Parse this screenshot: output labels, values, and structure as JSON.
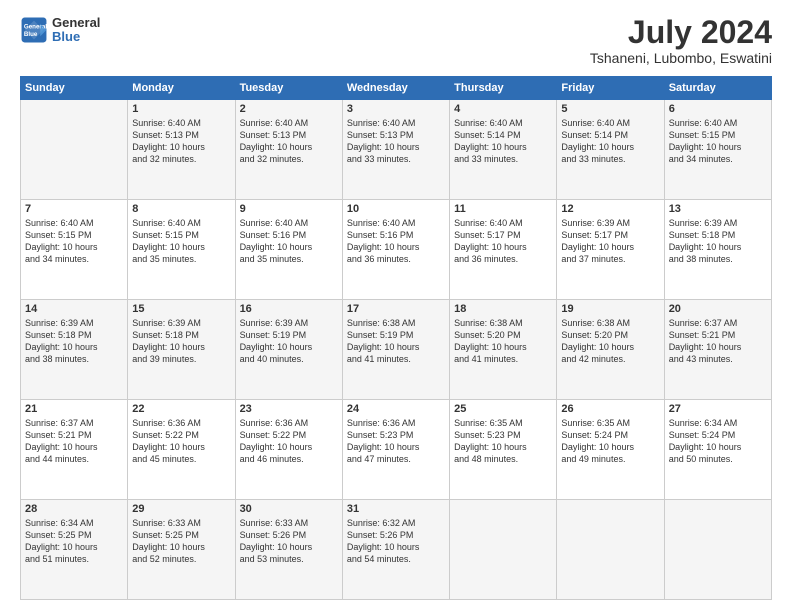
{
  "header": {
    "logo_line1": "General",
    "logo_line2": "Blue",
    "month": "July 2024",
    "location": "Tshaneni, Lubombo, Eswatini"
  },
  "days_of_week": [
    "Sunday",
    "Monday",
    "Tuesday",
    "Wednesday",
    "Thursday",
    "Friday",
    "Saturday"
  ],
  "weeks": [
    [
      {
        "day": "",
        "content": ""
      },
      {
        "day": "1",
        "content": "Sunrise: 6:40 AM\nSunset: 5:13 PM\nDaylight: 10 hours\nand 32 minutes."
      },
      {
        "day": "2",
        "content": "Sunrise: 6:40 AM\nSunset: 5:13 PM\nDaylight: 10 hours\nand 32 minutes."
      },
      {
        "day": "3",
        "content": "Sunrise: 6:40 AM\nSunset: 5:13 PM\nDaylight: 10 hours\nand 33 minutes."
      },
      {
        "day": "4",
        "content": "Sunrise: 6:40 AM\nSunset: 5:14 PM\nDaylight: 10 hours\nand 33 minutes."
      },
      {
        "day": "5",
        "content": "Sunrise: 6:40 AM\nSunset: 5:14 PM\nDaylight: 10 hours\nand 33 minutes."
      },
      {
        "day": "6",
        "content": "Sunrise: 6:40 AM\nSunset: 5:15 PM\nDaylight: 10 hours\nand 34 minutes."
      }
    ],
    [
      {
        "day": "7",
        "content": "Sunrise: 6:40 AM\nSunset: 5:15 PM\nDaylight: 10 hours\nand 34 minutes."
      },
      {
        "day": "8",
        "content": "Sunrise: 6:40 AM\nSunset: 5:15 PM\nDaylight: 10 hours\nand 35 minutes."
      },
      {
        "day": "9",
        "content": "Sunrise: 6:40 AM\nSunset: 5:16 PM\nDaylight: 10 hours\nand 35 minutes."
      },
      {
        "day": "10",
        "content": "Sunrise: 6:40 AM\nSunset: 5:16 PM\nDaylight: 10 hours\nand 36 minutes."
      },
      {
        "day": "11",
        "content": "Sunrise: 6:40 AM\nSunset: 5:17 PM\nDaylight: 10 hours\nand 36 minutes."
      },
      {
        "day": "12",
        "content": "Sunrise: 6:39 AM\nSunset: 5:17 PM\nDaylight: 10 hours\nand 37 minutes."
      },
      {
        "day": "13",
        "content": "Sunrise: 6:39 AM\nSunset: 5:18 PM\nDaylight: 10 hours\nand 38 minutes."
      }
    ],
    [
      {
        "day": "14",
        "content": "Sunrise: 6:39 AM\nSunset: 5:18 PM\nDaylight: 10 hours\nand 38 minutes."
      },
      {
        "day": "15",
        "content": "Sunrise: 6:39 AM\nSunset: 5:18 PM\nDaylight: 10 hours\nand 39 minutes."
      },
      {
        "day": "16",
        "content": "Sunrise: 6:39 AM\nSunset: 5:19 PM\nDaylight: 10 hours\nand 40 minutes."
      },
      {
        "day": "17",
        "content": "Sunrise: 6:38 AM\nSunset: 5:19 PM\nDaylight: 10 hours\nand 41 minutes."
      },
      {
        "day": "18",
        "content": "Sunrise: 6:38 AM\nSunset: 5:20 PM\nDaylight: 10 hours\nand 41 minutes."
      },
      {
        "day": "19",
        "content": "Sunrise: 6:38 AM\nSunset: 5:20 PM\nDaylight: 10 hours\nand 42 minutes."
      },
      {
        "day": "20",
        "content": "Sunrise: 6:37 AM\nSunset: 5:21 PM\nDaylight: 10 hours\nand 43 minutes."
      }
    ],
    [
      {
        "day": "21",
        "content": "Sunrise: 6:37 AM\nSunset: 5:21 PM\nDaylight: 10 hours\nand 44 minutes."
      },
      {
        "day": "22",
        "content": "Sunrise: 6:36 AM\nSunset: 5:22 PM\nDaylight: 10 hours\nand 45 minutes."
      },
      {
        "day": "23",
        "content": "Sunrise: 6:36 AM\nSunset: 5:22 PM\nDaylight: 10 hours\nand 46 minutes."
      },
      {
        "day": "24",
        "content": "Sunrise: 6:36 AM\nSunset: 5:23 PM\nDaylight: 10 hours\nand 47 minutes."
      },
      {
        "day": "25",
        "content": "Sunrise: 6:35 AM\nSunset: 5:23 PM\nDaylight: 10 hours\nand 48 minutes."
      },
      {
        "day": "26",
        "content": "Sunrise: 6:35 AM\nSunset: 5:24 PM\nDaylight: 10 hours\nand 49 minutes."
      },
      {
        "day": "27",
        "content": "Sunrise: 6:34 AM\nSunset: 5:24 PM\nDaylight: 10 hours\nand 50 minutes."
      }
    ],
    [
      {
        "day": "28",
        "content": "Sunrise: 6:34 AM\nSunset: 5:25 PM\nDaylight: 10 hours\nand 51 minutes."
      },
      {
        "day": "29",
        "content": "Sunrise: 6:33 AM\nSunset: 5:25 PM\nDaylight: 10 hours\nand 52 minutes."
      },
      {
        "day": "30",
        "content": "Sunrise: 6:33 AM\nSunset: 5:26 PM\nDaylight: 10 hours\nand 53 minutes."
      },
      {
        "day": "31",
        "content": "Sunrise: 6:32 AM\nSunset: 5:26 PM\nDaylight: 10 hours\nand 54 minutes."
      },
      {
        "day": "",
        "content": ""
      },
      {
        "day": "",
        "content": ""
      },
      {
        "day": "",
        "content": ""
      }
    ]
  ]
}
